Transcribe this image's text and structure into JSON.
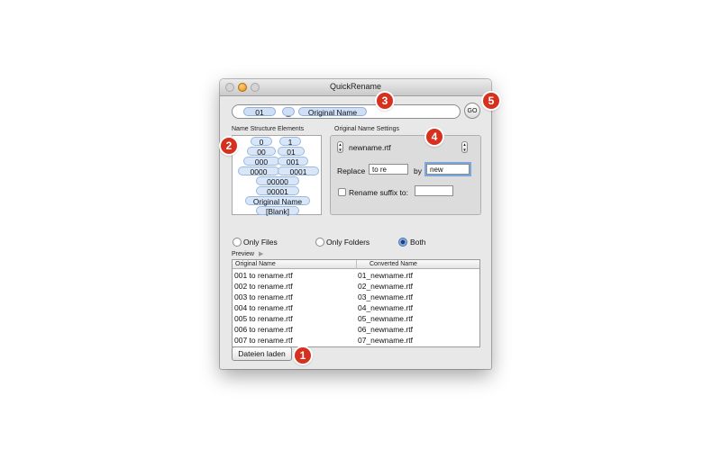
{
  "window": {
    "title": "QuickRename"
  },
  "token_field": {
    "tokens": [
      "01",
      "_",
      "Original Name"
    ],
    "go_label": "GO"
  },
  "structure": {
    "label": "Name Structure Elements",
    "items": [
      "0",
      "1",
      "00",
      "01",
      "000",
      "001",
      "0000",
      "0001",
      "00000",
      "00001",
      "Original Name",
      "[Blank]"
    ]
  },
  "settings": {
    "label": "Original Name Settings",
    "filename": "newname.rtf",
    "replace_label": "Replace",
    "replace_value": "to re",
    "by_label": "by",
    "by_value": "new",
    "suffix_label": "Rename suffix to:",
    "suffix_value": ""
  },
  "filter": {
    "options": [
      "Only Files",
      "Only Folders",
      "Both"
    ],
    "selected": "Both"
  },
  "preview": {
    "label": "Preview",
    "columns": [
      "Original Name",
      "Converted Name"
    ],
    "rows": [
      [
        "001 to rename.rtf",
        "01_newname.rtf"
      ],
      [
        "002 to rename.rtf",
        "02_newname.rtf"
      ],
      [
        "003 to rename.rtf",
        "03_newname.rtf"
      ],
      [
        "004 to rename.rtf",
        "04_newname.rtf"
      ],
      [
        "005 to rename.rtf",
        "05_newname.rtf"
      ],
      [
        "006 to rename.rtf",
        "06_newname.rtf"
      ],
      [
        "007 to rename.rtf",
        "07_newname.rtf"
      ]
    ]
  },
  "load_button": "Dateien laden",
  "callouts": [
    "1",
    "2",
    "3",
    "4",
    "5"
  ],
  "colors": {
    "callout": "#d6301f",
    "token": "#cfe0f6",
    "selection": "#7aa7de"
  }
}
